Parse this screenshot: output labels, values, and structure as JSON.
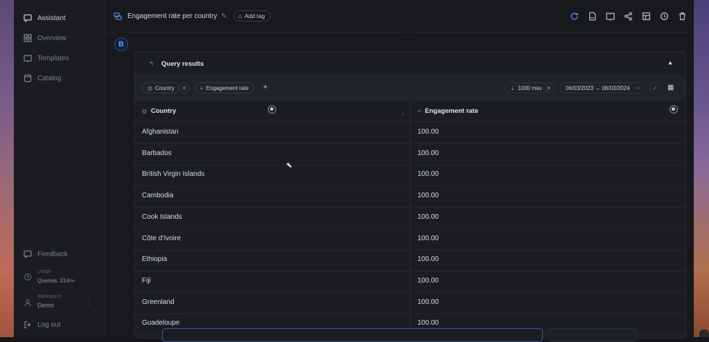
{
  "sidebar": {
    "items": [
      {
        "label": "Assistant",
        "icon": "chat-icon",
        "active": true
      },
      {
        "label": "Overview",
        "icon": "grid-icon",
        "active": false
      },
      {
        "label": "Templates",
        "icon": "book-icon",
        "active": false
      },
      {
        "label": "Catalog",
        "icon": "database-icon",
        "active": false
      }
    ],
    "bottom": {
      "feedback": "Feedback",
      "usage_label": "Usage",
      "usage_value": "Queries: 314/∞",
      "workspace_label": "Workspace",
      "workspace_value": "Demo",
      "logout": "Log out"
    }
  },
  "header": {
    "title": "Engagement rate per country",
    "add_tag": "Add tag",
    "actions": [
      "refresh-icon",
      "pdf-icon",
      "book-icon",
      "share-icon",
      "layout-icon",
      "history-icon",
      "trash-icon"
    ]
  },
  "query_panel": {
    "title": "Query results",
    "filters": {
      "dimension": "Country",
      "metric": "Engagement rate",
      "limit": "1000 max",
      "date_range": "06/03/2023 → 06/03/2024",
      "compare": "vs"
    },
    "columns": [
      "Country",
      "Engagement rate"
    ],
    "rows": [
      [
        "Afghanistan",
        "100.00"
      ],
      [
        "Barbados",
        "100.00"
      ],
      [
        "British Virgin Islands",
        "100.00"
      ],
      [
        "Cambodia",
        "100.00"
      ],
      [
        "Cook Islands",
        "100.00"
      ],
      [
        "Côte d’Ivoire",
        "100.00"
      ],
      [
        "Ethiopia",
        "100.00"
      ],
      [
        "Fiji",
        "100.00"
      ],
      [
        "Greenland",
        "100.00"
      ],
      [
        "Guadeloupe",
        "100.00"
      ]
    ]
  },
  "colors": {
    "accent": "#4a8fd6",
    "background": "#17191d",
    "panel": "#1b1d21"
  }
}
